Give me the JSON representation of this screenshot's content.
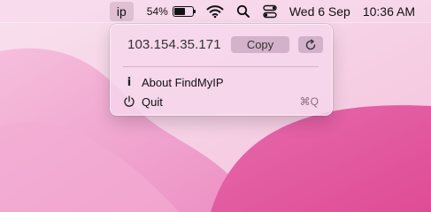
{
  "menubar": {
    "app_label": "ip",
    "battery": {
      "percent_text": "54%",
      "level": 0.54
    },
    "wifi_icon": "wifi-icon",
    "search_icon": "search-icon",
    "control_center_icon": "control-center-icon",
    "date": "Wed 6 Sep",
    "time": "10:36 AM"
  },
  "popup": {
    "ip_address": "103.154.35.171",
    "copy_label": "Copy",
    "refresh_icon": "refresh-icon",
    "items": [
      {
        "icon": "info-icon",
        "icon_glyph": "i",
        "label": "About FindMyIP"
      },
      {
        "icon": "power-icon",
        "label": "Quit",
        "shortcut": "⌘Q"
      }
    ]
  },
  "colors": {
    "wallpaper_light": "#f6d3e6",
    "wallpaper_mid": "#ee86c0",
    "wallpaper_deep": "#e04f98",
    "menu_background": "#f5d7eb",
    "button_tint": "#966e8c"
  }
}
